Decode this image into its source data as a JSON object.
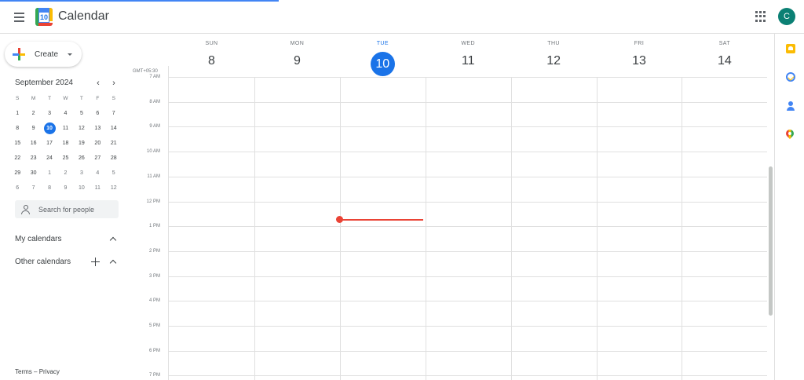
{
  "header": {
    "title": "Calendar",
    "logo_day": "10",
    "avatar_initial": "C"
  },
  "sidebar": {
    "create_label": "Create",
    "mini_calendar": {
      "title": "September 2024",
      "weekdays": [
        "S",
        "M",
        "T",
        "W",
        "T",
        "F",
        "S"
      ],
      "weeks": [
        [
          "1",
          "2",
          "3",
          "4",
          "5",
          "6",
          "7"
        ],
        [
          "8",
          "9",
          "10",
          "11",
          "12",
          "13",
          "14"
        ],
        [
          "15",
          "16",
          "17",
          "18",
          "19",
          "20",
          "21"
        ],
        [
          "22",
          "23",
          "24",
          "25",
          "26",
          "27",
          "28"
        ],
        [
          "29",
          "30",
          "1",
          "2",
          "3",
          "4",
          "5"
        ],
        [
          "6",
          "7",
          "8",
          "9",
          "10",
          "11",
          "12"
        ]
      ]
    },
    "search_people_placeholder": "Search for people",
    "my_calendars": "My calendars",
    "other_calendars": "Other calendars",
    "footer": {
      "terms": "Terms",
      "separator": "–",
      "privacy": "Privacy"
    }
  },
  "week": {
    "timezone": "GMT+05:30",
    "days": [
      {
        "dow": "SUN",
        "num": "8"
      },
      {
        "dow": "MON",
        "num": "9"
      },
      {
        "dow": "TUE",
        "num": "10"
      },
      {
        "dow": "WED",
        "num": "11"
      },
      {
        "dow": "THU",
        "num": "12"
      },
      {
        "dow": "FRI",
        "num": "13"
      },
      {
        "dow": "SAT",
        "num": "14"
      }
    ],
    "hours": [
      "7 AM",
      "8 AM",
      "9 AM",
      "10 AM",
      "11 AM",
      "12 PM",
      "1 PM",
      "2 PM",
      "3 PM",
      "4 PM",
      "5 PM",
      "6 PM",
      "7 PM"
    ]
  },
  "colors": {
    "accent": "#1a73e8",
    "now_indicator": "#ea4335",
    "avatar": "#0b8074"
  }
}
